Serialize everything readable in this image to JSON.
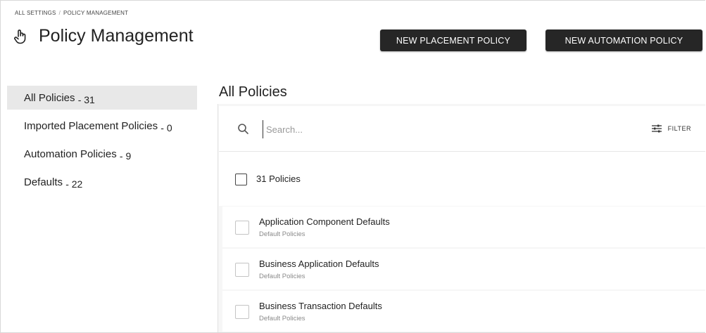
{
  "breadcrumb": {
    "root": "ALL SETTINGS",
    "separator": "/",
    "current": "POLICY MANAGEMENT"
  },
  "header": {
    "icon": "hand-pointer-icon",
    "title": "Policy Management",
    "new_placement_label": "NEW PLACEMENT POLICY",
    "new_automation_label": "NEW AUTOMATION POLICY"
  },
  "sidebar": {
    "items": [
      {
        "label": "All Policies",
        "count": "- 31",
        "active": true
      },
      {
        "label": "Imported Placement Policies",
        "count": "- 0",
        "active": false
      },
      {
        "label": "Automation Policies",
        "count": "- 9",
        "active": false
      },
      {
        "label": "Defaults",
        "count": "- 22",
        "active": false
      }
    ]
  },
  "main": {
    "title": "All Policies",
    "search": {
      "placeholder": "Search...",
      "value": ""
    },
    "filter_label": "FILTER",
    "select_all_label": "31 Policies",
    "policies": [
      {
        "name": "Application Component Defaults",
        "category": "Default Policies"
      },
      {
        "name": "Business Application Defaults",
        "category": "Default Policies"
      },
      {
        "name": "Business Transaction Defaults",
        "category": "Default Policies"
      }
    ]
  },
  "colors": {
    "button_bg": "#262626",
    "active_item_bg": "#e8e8e8",
    "panel_bg": "#f6f6f6"
  }
}
